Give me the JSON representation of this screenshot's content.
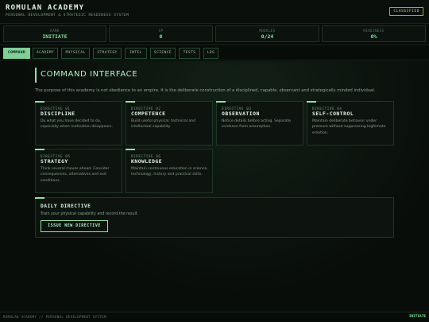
{
  "header": {
    "title": "ROMULAN ACADEMY",
    "subtitle": "PERSONAL DEVELOPMENT & STRATEGIC READINESS SYSTEM",
    "badge": "CLASSIFIED"
  },
  "stats": [
    {
      "label": "RANK",
      "value": "INITIATE"
    },
    {
      "label": "XP",
      "value": "0"
    },
    {
      "label": "MODULES",
      "value": "0/24"
    },
    {
      "label": "READINESS",
      "value": "0%"
    }
  ],
  "tabs": [
    "COMMAND",
    "ACADEMY",
    "PHYSICAL",
    "STRATEGY",
    "INTEL",
    "SCIENCE",
    "TESTS",
    "LOG"
  ],
  "active_tab": "COMMAND",
  "section": {
    "title": "COMMAND INTERFACE",
    "intro": "The purpose of this academy is not obedience to an empire. It is the deliberate construction of a disciplined, capable, observant and strategically minded individual."
  },
  "directives": [
    {
      "tag": "DIRECTIVE 01",
      "title": "DISCIPLINE",
      "text": "Do what you have decided to do, especially when motivation disappears."
    },
    {
      "tag": "DIRECTIVE 02",
      "title": "COMPETENCE",
      "text": "Build useful physical, technical and intellectual capability."
    },
    {
      "tag": "DIRECTIVE 03",
      "title": "OBSERVATION",
      "text": "Notice details before acting. Separate evidence from assumption."
    },
    {
      "tag": "DIRECTIVE 04",
      "title": "SELF-CONTROL",
      "text": "Maintain deliberate behavior under pressure without suppressing legitimate emotion."
    },
    {
      "tag": "DIRECTIVE 05",
      "title": "STRATEGY",
      "text": "Think several moves ahead. Consider consequences, alternatives and exit conditions."
    },
    {
      "tag": "DIRECTIVE 06",
      "title": "KNOWLEDGE",
      "text": "Maintain continuous education in science, technology, history and practical skills."
    }
  ],
  "daily": {
    "title": "DAILY DIRECTIVE",
    "text": "Train your physical capability and record the result.",
    "button": "ISSUE NEW DIRECTIVE"
  },
  "footer": {
    "left": "ROMULAN ACADEMY // PERSONAL DEVELOPMENT SYSTEM",
    "right": "INITIATE"
  },
  "colors": {
    "background": "#080c09",
    "accent": "#8de3a5",
    "accent_value": "#7fe39a",
    "badge_gold": "#b89a44"
  }
}
